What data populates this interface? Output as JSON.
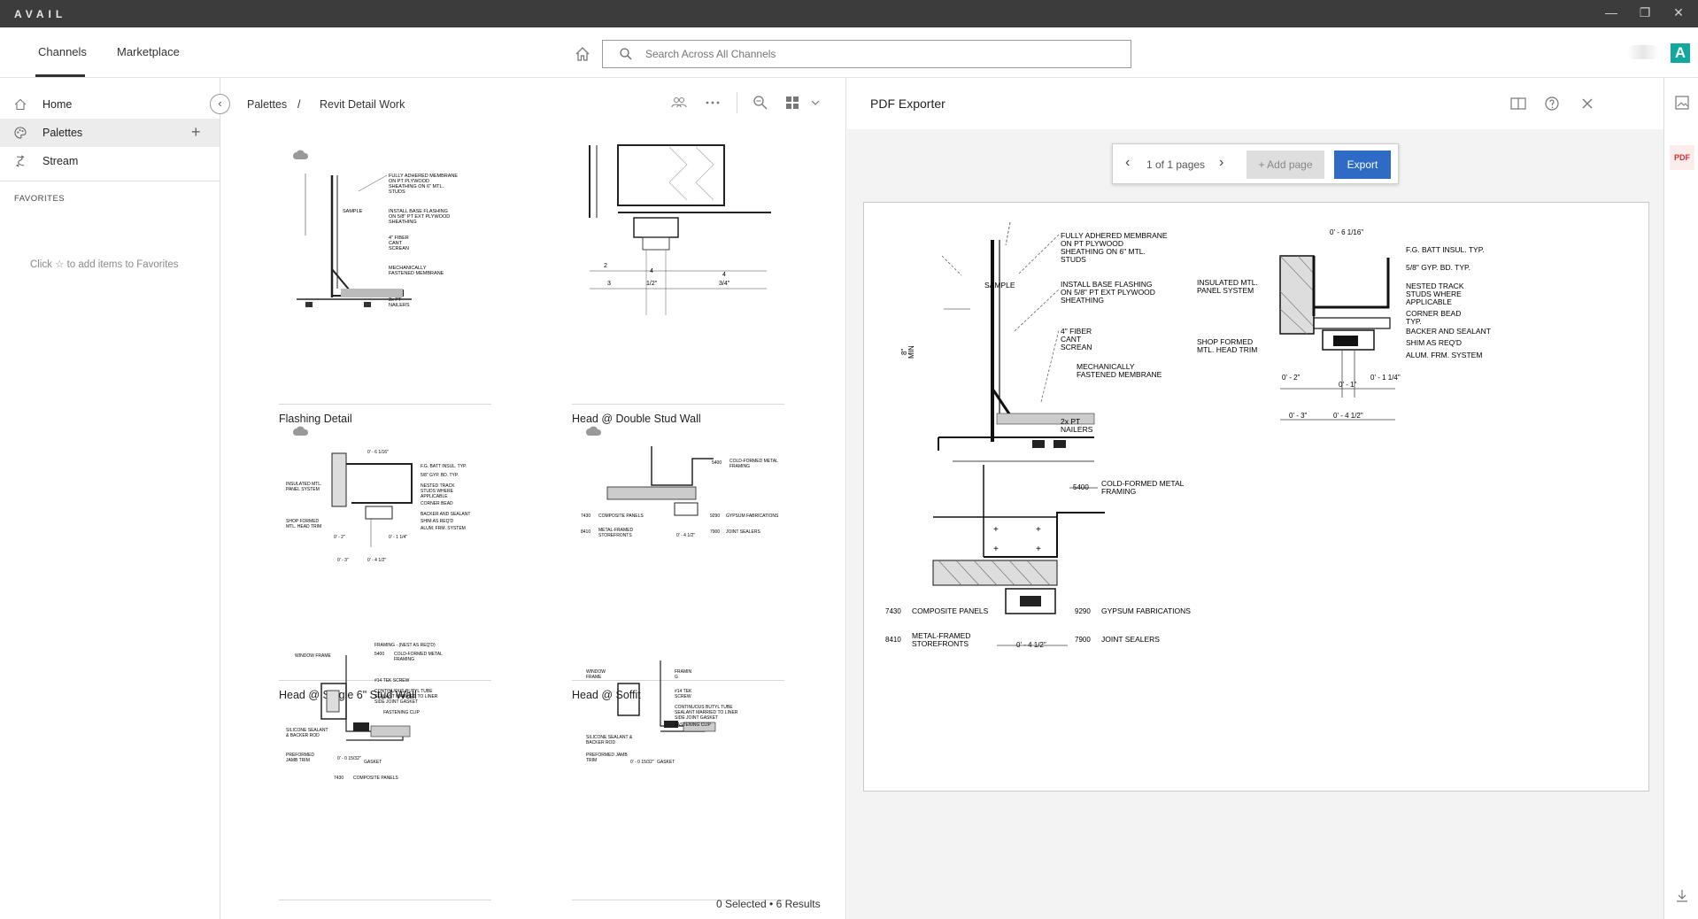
{
  "window": {
    "brand": "AVAIL",
    "controls": [
      "—",
      "❐",
      "✕"
    ]
  },
  "topnav": {
    "tabs": [
      "Channels",
      "Marketplace"
    ],
    "search_placeholder": "Search Across All Channels",
    "app_logo": "A"
  },
  "sidebar": {
    "items": [
      {
        "label": "Home",
        "icon": "home-icon"
      },
      {
        "label": "Palettes",
        "icon": "palette-icon"
      },
      {
        "label": "Stream",
        "icon": "stream-icon"
      }
    ],
    "favorites_title": "FAVORITES",
    "favorites_hint": "Click ☆ to add items to Favorites",
    "add_symbol": "+",
    "collapse_symbol": "‹"
  },
  "center": {
    "breadcrumb": [
      "Palettes",
      "/",
      "Revit Detail Work"
    ],
    "cards": [
      {
        "name": "Flashing Detail"
      },
      {
        "name": "Head @ Double Stud Wall"
      },
      {
        "name": "Head @ Single 6\"  Stud Wall"
      },
      {
        "name": "Head @ Soffit"
      },
      {
        "name": ""
      },
      {
        "name": ""
      }
    ],
    "status": "0 Selected  •  6 Results"
  },
  "exporter": {
    "title": "PDF Exporter",
    "pager_text": "1 of 1 pages",
    "prev_symbol": "‹",
    "next_symbol": "›",
    "add_page_label": "+ Add page",
    "export_label": "Export",
    "pdf_badge": "PDF"
  },
  "drawing": {
    "flashing": [
      "FULLY ADHERED MEMBRANE",
      "ON PT PLYWOOD",
      "SHEATHING ON 6\" MTL.",
      "STUDS",
      "SAMPLE",
      "INSTALL BASE FLASHING",
      "ON 5/8\" PT EXT PLYWOOD",
      "SHEATHING",
      "4\" FIBER",
      "CANT",
      "SCREAN",
      "MECHANICALLY",
      "FASTENED MEMBRANE",
      "2x PT",
      "NAILERS",
      "8\"",
      "MIN"
    ],
    "head": [
      "0' - 6 1/16\"",
      "F.G. BATT INSUL. TYP.",
      "5/8\" GYP. BD. TYP.",
      "INSULATED MTL.",
      "PANEL SYSTEM",
      "NESTED TRACK",
      "STUDS WHERE",
      "APPLICABLE",
      "CORNER BEAD",
      "TYP.",
      "BACKER AND SEALANT",
      "SHIM AS REQ'D",
      "ALUM. FRM. SYSTEM",
      "SHOP FORMED",
      "MTL. HEAD TRIM",
      "0' - 2\"",
      "0' - 1\"",
      "0' - 1 1/4\"",
      "0' - 3\"",
      "0' - 4 1/2\""
    ],
    "soffit": [
      "5400",
      "COLD-FORMED METAL",
      "FRAMING",
      "7430",
      "COMPOSITE PANELS",
      "9290",
      "GYPSUM FABRICATIONS",
      "8410",
      "METAL-FRAMED",
      "STOREFRONTS",
      "7900",
      "JOINT SEALERS",
      "0' - 4 1/2\""
    ]
  }
}
